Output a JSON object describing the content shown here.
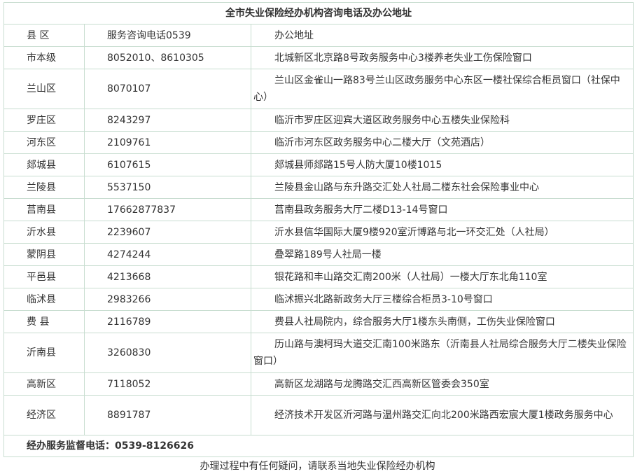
{
  "table": {
    "title": "全市失业保险经办机构咨询电话及办公地址",
    "headers": [
      "县 区",
      "服务咨询电话0539",
      "办公地址"
    ],
    "rows": [
      {
        "district": "市本级",
        "phone": "8052010、8610305",
        "address": "北城新区北京路8号政务服务中心3楼养老失业工伤保险窗口"
      },
      {
        "district": "兰山区",
        "phone": "8070107",
        "address": "兰山区金雀山一路83号兰山区政务服务中心东区一楼社保综合柜员窗口（社保中心）"
      },
      {
        "district": "罗庄区",
        "phone": "8243297",
        "address": "临沂市罗庄区迎宾大道区政务服务中心五楼失业保险科"
      },
      {
        "district": "河东区",
        "phone": "2109761",
        "address": "临沂市河东区政务服务中心二楼大厅（文苑酒店）"
      },
      {
        "district": "郯城县",
        "phone": "6107615",
        "address": "郯城县师郯路15号人防大厦10楼1015"
      },
      {
        "district": "兰陵县",
        "phone": "5537150",
        "address": "兰陵县金山路与东升路交汇处人社局二楼东社会保险事业中心"
      },
      {
        "district": "莒南县",
        "phone": "17662877837",
        "address": "莒南县政务服务大厅二楼D13-14号窗口"
      },
      {
        "district": "沂水县",
        "phone": "2239607",
        "address": "沂水县信华国际大厦9楼920室沂博路与北一环交汇处（人社局）"
      },
      {
        "district": "蒙阴县",
        "phone": "4274244",
        "address": "叠翠路189号人社局一楼"
      },
      {
        "district": "平邑县",
        "phone": "4213668",
        "address": "银花路和丰山路交汇南200米（人社局）一楼大厅东北角110室"
      },
      {
        "district": "临沭县",
        "phone": "2983266",
        "address": "临沭振兴北路新政务大厅三楼综合柜员3-10号窗口"
      },
      {
        "district": "费 县",
        "phone": "2116789",
        "address": "费县人社局院内，综合服务大厅1楼东头南侧，工伤失业保险窗口"
      },
      {
        "district": "沂南县",
        "phone": "3260830",
        "address": "历山路与澳柯玛大道交汇南100米路东（沂南县人社局综合服务大厅二楼失业保险窗口）"
      },
      {
        "district": "高新区",
        "phone": "7118052",
        "address": "高新区龙湖路与龙腾路交汇西高新区管委会350室"
      },
      {
        "district": "经济区",
        "phone": "8891787",
        "address": "经济技术开发区沂河路与温州路交汇向北200米路西宏宸大厦1楼政务服务中心"
      }
    ],
    "footer": "经办服务监督电话：0539-8126626"
  },
  "note": "办理过程中有任何疑问，请联系当地失业保险经办机构",
  "colors": {
    "border": "#c8ddd0",
    "text": "#333333"
  }
}
